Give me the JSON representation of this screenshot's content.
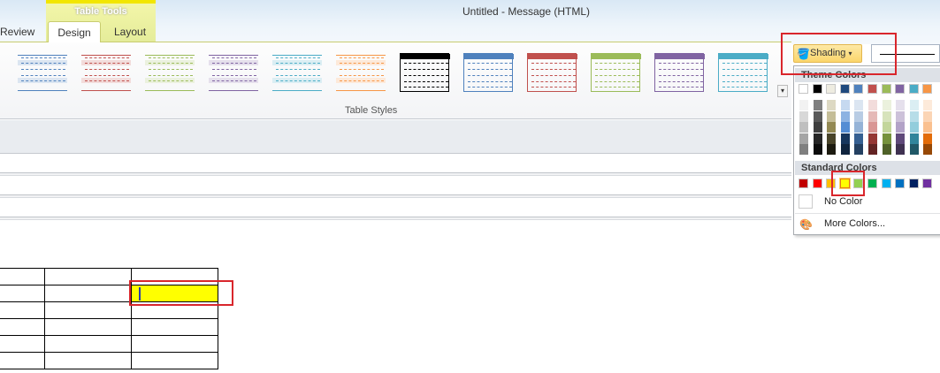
{
  "window": {
    "title": "Untitled  -  Message (HTML)"
  },
  "ribbon": {
    "context_tab_group": "Table Tools",
    "tabs": [
      {
        "label": "Review"
      },
      {
        "label": "Design",
        "active": true
      },
      {
        "label": "Layout"
      }
    ],
    "group_label": "Table Styles",
    "table_styles": [
      {
        "color": "#4f81bd",
        "band": "#dbe5f1",
        "kind": "light"
      },
      {
        "color": "#c0504d",
        "band": "#f2dcdb",
        "kind": "light"
      },
      {
        "color": "#9bbb59",
        "band": "#ebf1de",
        "kind": "light"
      },
      {
        "color": "#8064a2",
        "band": "#e5e0ec",
        "kind": "light"
      },
      {
        "color": "#4bacc6",
        "band": "#dbeef3",
        "kind": "light"
      },
      {
        "color": "#f79646",
        "band": "#fde9d9",
        "kind": "light"
      },
      {
        "color": "#000000",
        "kind": "grid"
      },
      {
        "color": "#4f81bd",
        "kind": "grid"
      },
      {
        "color": "#c0504d",
        "kind": "grid"
      },
      {
        "color": "#9bbb59",
        "kind": "grid"
      },
      {
        "color": "#8064a2",
        "kind": "grid"
      },
      {
        "color": "#4bacc6",
        "kind": "grid"
      }
    ]
  },
  "shading": {
    "button_label": "Shading",
    "theme_colors_label": "Theme Colors",
    "theme_colors": [
      "#ffffff",
      "#000000",
      "#eeece1",
      "#1f497d",
      "#4f81bd",
      "#c0504d",
      "#9bbb59",
      "#8064a2",
      "#4bacc6",
      "#f79646"
    ],
    "theme_shades": [
      [
        "#f2f2f2",
        "#d8d8d8",
        "#bfbfbf",
        "#a5a5a5",
        "#7f7f7f"
      ],
      [
        "#7f7f7f",
        "#595959",
        "#3f3f3f",
        "#262626",
        "#0c0c0c"
      ],
      [
        "#ddd9c3",
        "#c4bd97",
        "#938953",
        "#494429",
        "#1d1b10"
      ],
      [
        "#c6d9f0",
        "#8db3e2",
        "#548dd4",
        "#17365d",
        "#0f243e"
      ],
      [
        "#dbe5f1",
        "#b8cce4",
        "#95b3d7",
        "#366092",
        "#244061"
      ],
      [
        "#f2dcdb",
        "#e5b9b7",
        "#d99694",
        "#953734",
        "#632423"
      ],
      [
        "#ebf1dd",
        "#d7e3bc",
        "#c3d69b",
        "#76923c",
        "#4f6128"
      ],
      [
        "#e5e0ec",
        "#ccc1d9",
        "#b2a2c7",
        "#5f497a",
        "#3f3151"
      ],
      [
        "#dbeef3",
        "#b7dde8",
        "#92cddc",
        "#31859b",
        "#205867"
      ],
      [
        "#fdeada",
        "#fbd5b5",
        "#fac08f",
        "#e36c09",
        "#974806"
      ]
    ],
    "standard_colors_label": "Standard Colors",
    "standard_colors": [
      "#c00000",
      "#ff0000",
      "#ffc000",
      "#ffff00",
      "#92d050",
      "#00b050",
      "#00b0f0",
      "#0070c0",
      "#002060",
      "#7030a0"
    ],
    "selected_standard": 3,
    "no_color_label": "No Color",
    "more_colors_label": "More Colors..."
  },
  "document_table": {
    "rows": 6,
    "cols": 3,
    "shaded_cell": {
      "row": 1,
      "col": 2,
      "color": "#ffff00"
    }
  }
}
